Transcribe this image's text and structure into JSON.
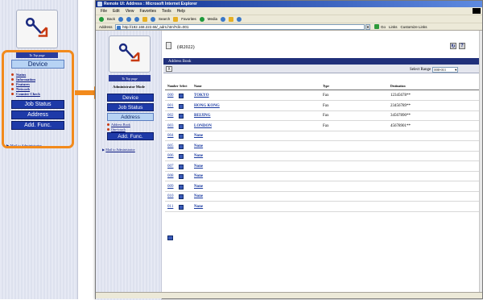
{
  "leftnav": {
    "to_top": "To Top page",
    "admin_mode": "Administrator Mode",
    "device_button": "Device",
    "links": [
      "Status",
      "Information",
      "Features",
      "Network",
      "Counter Check"
    ],
    "buttons": [
      "Job Status",
      "Address",
      "Add. Func."
    ],
    "mailto": "Mail to Administrator"
  },
  "browser": {
    "title": "Remote UI: Address : Microsoft Internet Explorer",
    "menu": [
      "File",
      "Edit",
      "View",
      "Favorites",
      "Tools",
      "Help"
    ],
    "toolbar": [
      "Back",
      "Forward",
      "Stop",
      "Refresh",
      "Home",
      "Search",
      "Favorites",
      "Media",
      "History",
      "Mail",
      "Print"
    ],
    "address_label": "Address",
    "address_value": "http://192.168.222.66/_adrs.html?dir=001",
    "go_label": "Go",
    "links_label": "Links",
    "customize_links": "Customize Links"
  },
  "innernav": {
    "to_top": "To Top page",
    "admin_mode": "Administrator Mode",
    "buttons": [
      "Device",
      "Job Status",
      "Address"
    ],
    "sublinks": [
      "Address Book",
      "One-touch"
    ],
    "add_func": "Add. Func.",
    "mailto": "Mail to Administrator"
  },
  "main": {
    "device_name": "(iR2022)",
    "section_title": "Address Book",
    "close_label": "X",
    "select_range_label": "Select Range",
    "select_range_value": "000-011",
    "columns": {
      "number": "Number",
      "select": "Select",
      "name": "Name",
      "type": "Type",
      "destination": "Destination"
    },
    "rows": [
      {
        "number": "000",
        "name": "TOKYO",
        "type": "Fax",
        "destination": "12345678**"
      },
      {
        "number": "001",
        "name": "HONG KONG",
        "type": "Fax",
        "destination": "23456789**"
      },
      {
        "number": "002",
        "name": "BEIJING",
        "type": "Fax",
        "destination": "34567890**"
      },
      {
        "number": "003",
        "name": "LONDON",
        "type": "Fax",
        "destination": "45678901**"
      },
      {
        "number": "004",
        "name": "None",
        "type": "",
        "destination": ""
      },
      {
        "number": "005",
        "name": "None",
        "type": "",
        "destination": ""
      },
      {
        "number": "006",
        "name": "None",
        "type": "",
        "destination": ""
      },
      {
        "number": "007",
        "name": "None",
        "type": "",
        "destination": ""
      },
      {
        "number": "008",
        "name": "None",
        "type": "",
        "destination": ""
      },
      {
        "number": "009",
        "name": "None",
        "type": "",
        "destination": ""
      },
      {
        "number": "010",
        "name": "None",
        "type": "",
        "destination": ""
      },
      {
        "number": "011",
        "name": "None",
        "type": "",
        "destination": ""
      }
    ]
  },
  "colors": {
    "accent_orange": "#f28a1c",
    "nav_blue": "#1e3aa8",
    "nav_light": "#b7d3f4",
    "header_bar": "#20307a"
  }
}
